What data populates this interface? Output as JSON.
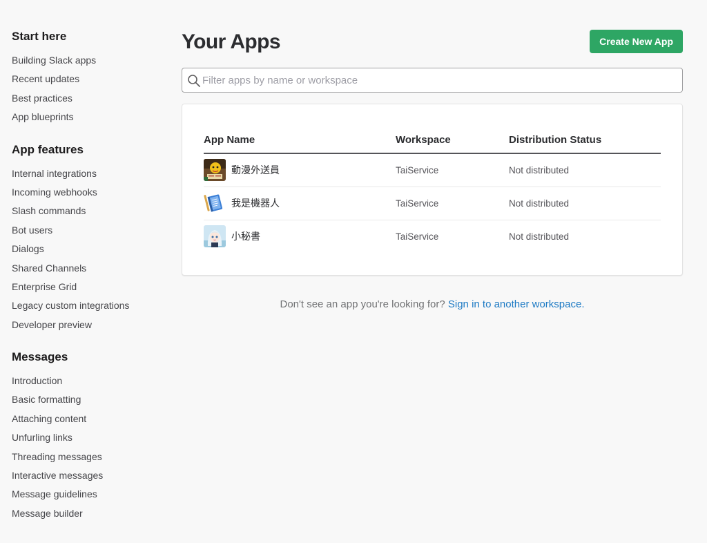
{
  "sidebar": {
    "sections": [
      {
        "heading": "Start here",
        "items": [
          "Building Slack apps",
          "Recent updates",
          "Best practices",
          "App blueprints"
        ]
      },
      {
        "heading": "App features",
        "items": [
          "Internal integrations",
          "Incoming webhooks",
          "Slash commands",
          "Bot users",
          "Dialogs",
          "Shared Channels",
          "Enterprise Grid",
          "Legacy custom integrations",
          "Developer preview"
        ]
      },
      {
        "heading": "Messages",
        "items": [
          "Introduction",
          "Basic formatting",
          "Attaching content",
          "Unfurling links",
          "Threading messages",
          "Interactive messages",
          "Message guidelines",
          "Message builder"
        ]
      }
    ]
  },
  "main": {
    "title": "Your Apps",
    "create_button_label": "Create New App",
    "search": {
      "placeholder": "Filter apps by name or workspace",
      "value": ""
    },
    "table": {
      "headers": [
        "App Name",
        "Workspace",
        "Distribution Status"
      ],
      "rows": [
        {
          "name": "動漫外送員",
          "workspace": "TaiService",
          "status": "Not distributed",
          "icon": "anime-delivery-icon"
        },
        {
          "name": "我是機器人",
          "workspace": "TaiService",
          "status": "Not distributed",
          "icon": "blue-notebook-icon"
        },
        {
          "name": "小秘書",
          "workspace": "TaiService",
          "status": "Not distributed",
          "icon": "anime-girl-icon"
        }
      ]
    },
    "footer": {
      "text": "Don't see an app you're looking for? ",
      "link": "Sign in to another workspace."
    }
  },
  "colors": {
    "accent_green": "#2ea664",
    "link_blue": "#1d7ac4",
    "background": "#f8f8f8"
  }
}
